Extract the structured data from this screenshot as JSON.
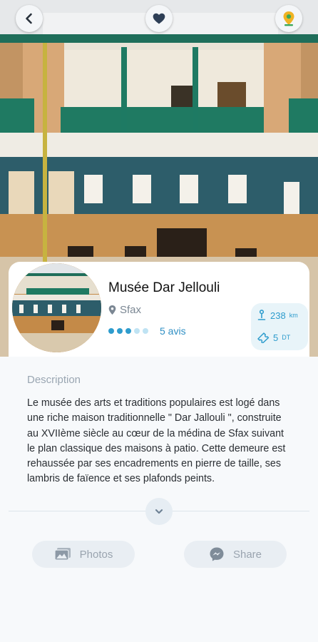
{
  "place": {
    "name": "Musée Dar Jellouli",
    "city": "Sfax",
    "rating": 3,
    "rating_max": 5,
    "reviews_label": "5 avis",
    "distance_value": "238",
    "distance_unit": "km",
    "price_value": "5",
    "price_unit": "DT"
  },
  "description": {
    "heading": "Description",
    "text": "Le musée des arts et traditions populaires est logé dans une riche maison traditionnelle \" Dar Jallouli \", construite au XVIIème siècle au cœur de la médina de Sfax suivant le plan classique des maisons à patio. Cette demeure est rehaussée par ses encadrements en pierre de taille, ses lambris de faïence et ses plafonds peints."
  },
  "actions": {
    "photos_label": "Photos",
    "share_label": "Share"
  },
  "icons": {
    "back": "back-arrow-icon",
    "favorite": "heart-icon",
    "map": "map-pin-icon",
    "location": "location-pin-icon",
    "distance": "route-icon",
    "price": "ticket-icon",
    "expand": "chevron-down-icon",
    "photos": "image-gallery-icon",
    "share": "messenger-icon"
  },
  "colors": {
    "accent": "#2e9ccd",
    "rating_active": "#2e9ccd",
    "rating_inactive": "#bfe3f3",
    "map_pin": "#f0b323",
    "map_pin_inner": "#3aa85a"
  }
}
